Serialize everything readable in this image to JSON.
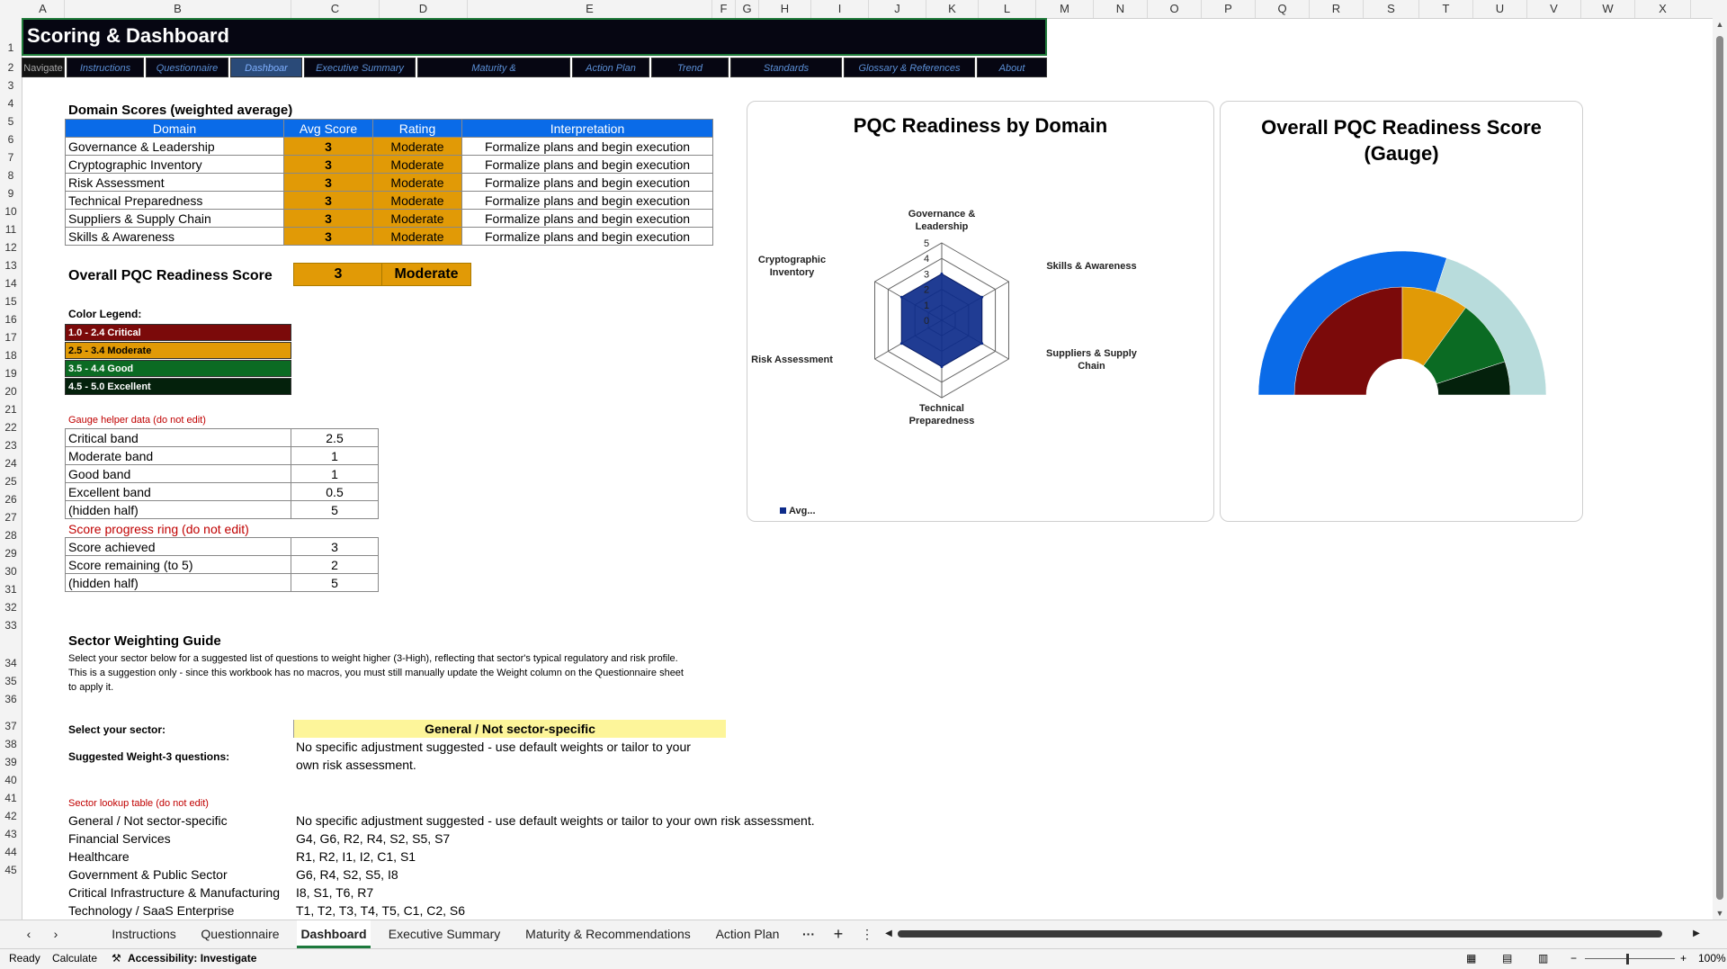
{
  "columns": [
    "A",
    "B",
    "C",
    "D",
    "E",
    "F",
    "G",
    "H",
    "I",
    "J",
    "K",
    "L",
    "M",
    "N",
    "O",
    "P",
    "Q",
    "R",
    "S",
    "T",
    "U",
    "V",
    "W",
    "X"
  ],
  "title": "Scoring & Dashboard",
  "nav": {
    "label": "Navigate",
    "items": [
      "Instructions",
      "Questionnaire",
      "Dashboar",
      "Executive Summary",
      "Maturity &",
      "Action Plan",
      "Trend",
      "Standards",
      "Glossary & References",
      "About"
    ]
  },
  "domain_scores": {
    "heading": "Domain Scores  (weighted average)",
    "headers": [
      "Domain",
      "Avg Score",
      "Rating",
      "Interpretation"
    ],
    "rows": [
      [
        "Governance & Leadership",
        "3",
        "Moderate",
        "Formalize plans and begin execution"
      ],
      [
        "Cryptographic Inventory",
        "3",
        "Moderate",
        "Formalize plans and begin execution"
      ],
      [
        "Risk Assessment",
        "3",
        "Moderate",
        "Formalize plans and begin execution"
      ],
      [
        "Technical Preparedness",
        "3",
        "Moderate",
        "Formalize plans and begin execution"
      ],
      [
        "Suppliers & Supply Chain",
        "3",
        "Moderate",
        "Formalize plans and begin execution"
      ],
      [
        "Skills & Awareness",
        "3",
        "Moderate",
        "Formalize plans and begin execution"
      ]
    ]
  },
  "overall": {
    "label": "Overall PQC Readiness Score",
    "score": "3",
    "rating": "Moderate"
  },
  "color_legend": {
    "title": "Color Legend:",
    "items": [
      {
        "text": "1.0 - 2.4 Critical",
        "bg": "#7b0a0a",
        "fg": "#ffffff"
      },
      {
        "text": "2.5 - 3.4 Moderate",
        "bg": "#e19a06",
        "fg": "#000000"
      },
      {
        "text": "3.5 - 4.4 Good",
        "bg": "#0b6b23",
        "fg": "#ffffff"
      },
      {
        "text": "4.5 - 5.0 Excellent",
        "bg": "#04210c",
        "fg": "#ffffff"
      }
    ]
  },
  "gauge_helper": {
    "title": "Gauge helper data (do not edit)",
    "rows": [
      [
        "Critical band",
        "2.5"
      ],
      [
        "Moderate band",
        "1"
      ],
      [
        "Good band",
        "1"
      ],
      [
        "Excellent band",
        "0.5"
      ],
      [
        "(hidden half)",
        "5"
      ]
    ]
  },
  "score_ring": {
    "title": "Score progress ring (do not edit)",
    "rows": [
      [
        "Score achieved",
        "3"
      ],
      [
        "Score remaining (to 5)",
        "2"
      ],
      [
        "(hidden half)",
        "5"
      ]
    ]
  },
  "sector_guide": {
    "heading": "Sector Weighting Guide",
    "desc1": "Select your sector below for a suggested list of questions to weight higher (3-High), reflecting that sector's typical regulatory and risk profile.",
    "desc2": "This is a suggestion only - since this workbook has no macros, you must still manually update the Weight column on the Questionnaire sheet",
    "desc3": "to apply it.",
    "select_label": "Select your sector:",
    "select_value": "General / Not sector-specific",
    "suggest_label": "Suggested Weight-3 questions:",
    "suggest_line1": "No specific adjustment suggested - use default weights or tailor to your",
    "suggest_line2": "own risk assessment.",
    "lookup_title": "Sector lookup table (do not edit)",
    "lookup": [
      [
        "General / Not sector-specific",
        "No specific adjustment suggested - use default weights or tailor to your own risk assessment."
      ],
      [
        "Financial Services",
        "G4, G6, R2, R4, S2, S5, S7"
      ],
      [
        "Healthcare",
        "R1, R2, I1, I2, C1, S1"
      ],
      [
        "Government & Public Sector",
        "G6, R4, S2, S5, I8"
      ],
      [
        "Critical Infrastructure & Manufacturing",
        "I8, S1, T6, R7"
      ],
      [
        "Technology / SaaS Enterprise",
        "T1, T2, T3, T4, T5, C1, C2, S6"
      ]
    ]
  },
  "chart_data": [
    {
      "type": "radar",
      "title": "PQC Readiness by Domain",
      "axes": [
        "Governance & Leadership",
        "Skills & Awareness",
        "Suppliers & Supply Chain",
        "Technical Preparedness",
        "Risk Assessment",
        "Cryptographic Inventory"
      ],
      "axes_lines": [
        [
          "Governance &",
          "Leadership"
        ],
        [
          "Skills & Awareness"
        ],
        [
          "Suppliers & Supply",
          "Chain"
        ],
        [
          "Technical",
          "Preparedness"
        ],
        [
          "Risk Assessment"
        ],
        [
          "Cryptographic",
          "Inventory"
        ]
      ],
      "series": [
        {
          "name": "Avg...",
          "values": [
            3,
            3,
            3,
            3,
            3,
            3
          ],
          "color": "#0d2b8a"
        }
      ],
      "ticks": [
        "0",
        "1",
        "2",
        "3",
        "4",
        "5"
      ],
      "range": [
        0,
        5
      ],
      "legend": "bottom-left"
    },
    {
      "type": "doughnut-gauge",
      "title_lines": [
        "Overall PQC Readiness Score",
        "(Gauge)"
      ],
      "outer_ring": {
        "values": [
          3,
          2,
          5
        ],
        "colors": [
          "#0a6be8",
          "#b8dcdc",
          "none"
        ]
      },
      "inner_ring": {
        "values": [
          2.5,
          1,
          1,
          0.5,
          5
        ],
        "colors": [
          "#7b0a0a",
          "#e19a06",
          "#0b6b23",
          "#04210c",
          "none"
        ]
      }
    }
  ],
  "sheet_tabs": [
    "Instructions",
    "Questionnaire",
    "Dashboard",
    "Executive Summary",
    "Maturity & Recommendations",
    "Action Plan"
  ],
  "tabs_more": "···",
  "tabs_add": "+",
  "status": {
    "ready": "Ready",
    "calculate": "Calculate",
    "accessibility": "Accessibility: Investigate",
    "zoom": "100%"
  }
}
